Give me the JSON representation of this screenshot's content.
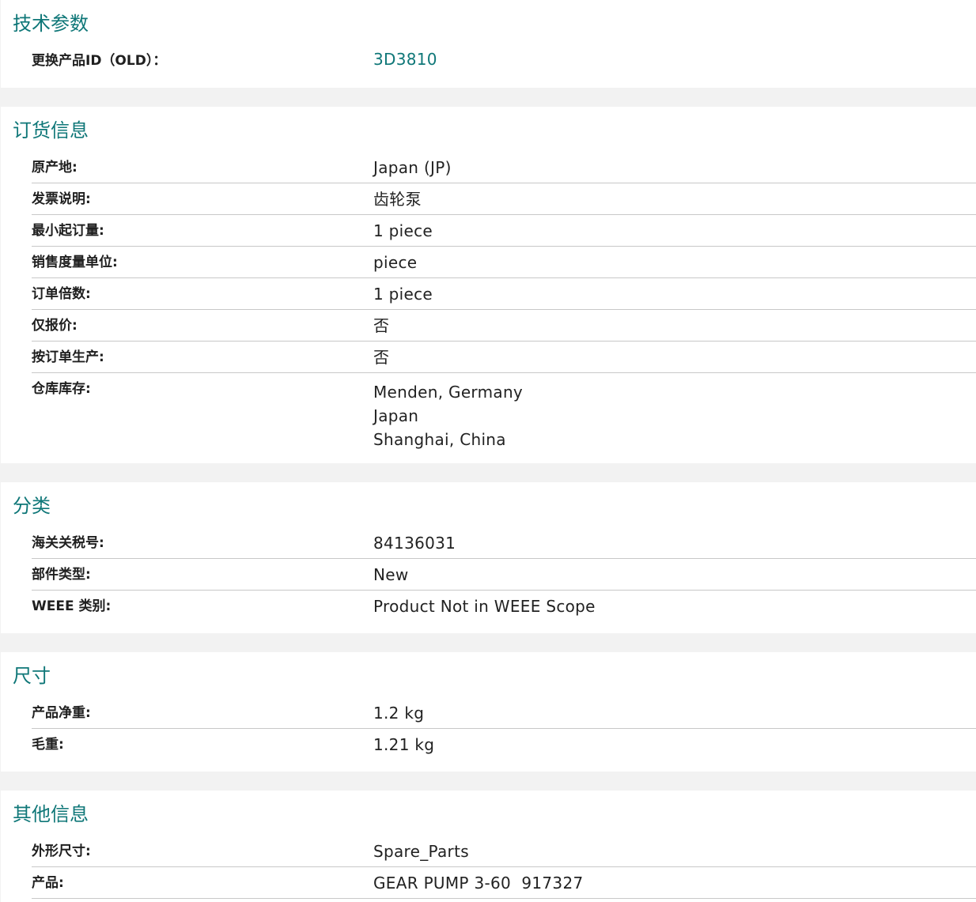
{
  "sections": {
    "tech": {
      "title": "技术参数",
      "rows": [
        {
          "label": "更换产品ID（OLD）：",
          "value": "3D3810"
        }
      ]
    },
    "order": {
      "title": "订货信息",
      "rows": [
        {
          "label": "原产地:",
          "value": "Japan (JP)"
        },
        {
          "label": "发票说明:",
          "value": "齿轮泵"
        },
        {
          "label": "最小起订量:",
          "value": "1 piece"
        },
        {
          "label": "销售度量单位:",
          "value": "piece"
        },
        {
          "label": "订单倍数:",
          "value": "1 piece"
        },
        {
          "label": "仅报价:",
          "value": "否"
        },
        {
          "label": "按订单生产:",
          "value": "否"
        },
        {
          "label": "仓库库存:",
          "values": [
            "Menden, Germany",
            "Japan",
            "Shanghai, China"
          ]
        }
      ]
    },
    "classification": {
      "title": "分类",
      "rows": [
        {
          "label": "海关关税号:",
          "value": "84136031"
        },
        {
          "label": "部件类型:",
          "value": "New"
        },
        {
          "label": "WEEE 类别:",
          "value": "Product Not in WEEE Scope"
        }
      ]
    },
    "dimensions": {
      "title": "尺寸",
      "rows": [
        {
          "label": "产品净重:",
          "value": "1.2 kg"
        },
        {
          "label": "毛重:",
          "value": "1.21 kg"
        }
      ]
    },
    "other": {
      "title": "其他信息",
      "rows": [
        {
          "label": "外形尺寸:",
          "value": "Spare_Parts"
        },
        {
          "label": "产品:",
          "value": "GEAR PUMP 3-60  917327"
        }
      ]
    }
  },
  "colors": {
    "accent": "#0f7778",
    "divider": "#c8c8c8",
    "gap": "#f2f2f2"
  }
}
